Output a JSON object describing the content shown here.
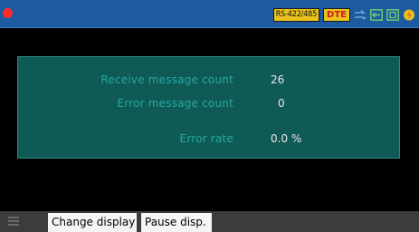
{
  "status_bar": {
    "port_label": "RS-422/485",
    "mode_label": "DTE",
    "record_color": "#ff2a2a",
    "icons": [
      "record-indicator-icon",
      "link-arrow-icon",
      "usb-icon",
      "memory-card-icon",
      "power-icon"
    ]
  },
  "stats": {
    "receive_label": "Receive message count",
    "receive_value": "26",
    "error_label": "Error message count",
    "error_value": "0",
    "rate_label": "Error rate",
    "rate_value": "0.0 %"
  },
  "toolbar": {
    "change_display": "Change display",
    "pause_display": "Pause disp."
  },
  "colors": {
    "top_bar": "#1e5aa0",
    "panel": "#0f5a55",
    "label_text": "#25a89f",
    "badge": "#e9c21d"
  }
}
